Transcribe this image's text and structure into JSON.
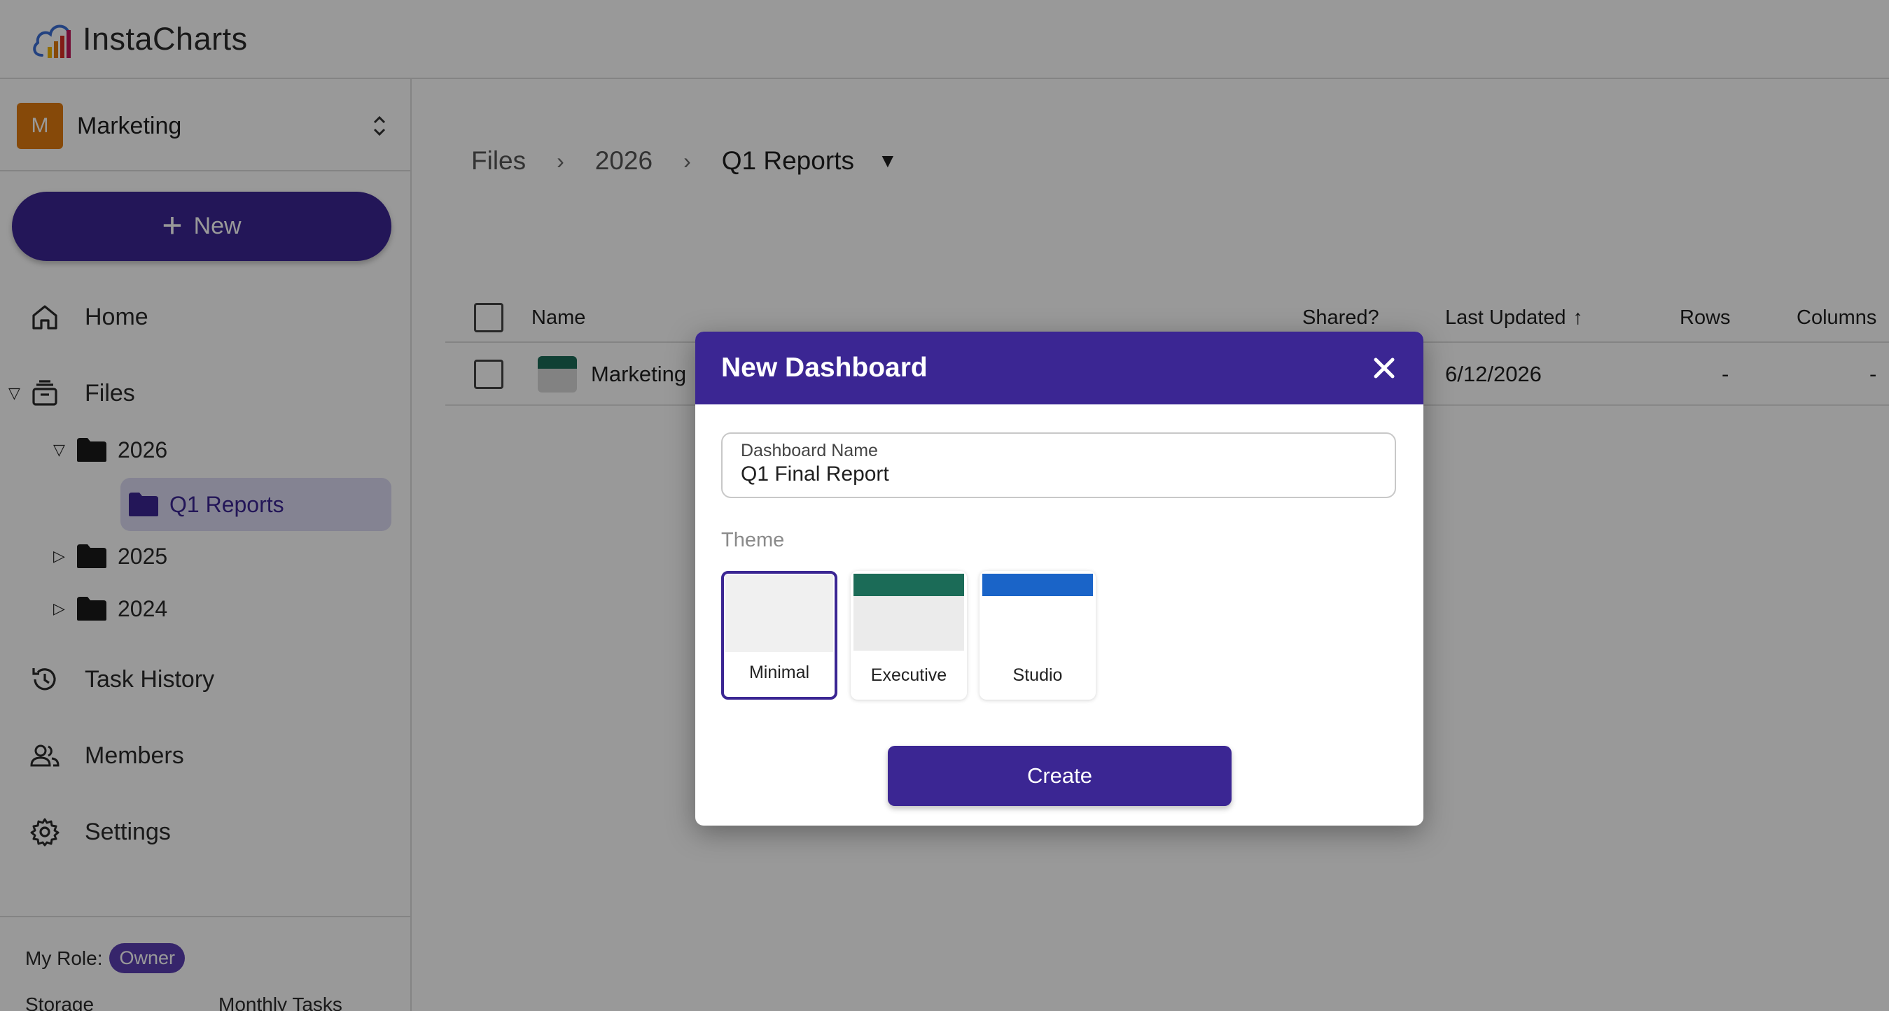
{
  "app": {
    "name": "InstaCharts"
  },
  "workspace": {
    "initial": "M",
    "name": "Marketing",
    "avatar_color": "#e07a10"
  },
  "sidebar": {
    "new_label": "New",
    "nav": {
      "home": "Home",
      "files": "Files",
      "task_history": "Task History",
      "members": "Members",
      "settings": "Settings"
    },
    "tree": {
      "y2026": "2026",
      "q1_reports": "Q1 Reports",
      "y2025": "2025",
      "y2024": "2024"
    },
    "role_label": "My Role:",
    "role_value": "Owner",
    "storage_label": "Storage",
    "monthly_tasks_label": "Monthly Tasks"
  },
  "breadcrumb": {
    "root": "Files",
    "level1": "2026",
    "current": "Q1 Reports"
  },
  "table": {
    "headers": {
      "name": "Name",
      "shared": "Shared?",
      "last_updated": "Last Updated",
      "sort_indicator": "↑",
      "rows": "Rows",
      "columns": "Columns"
    },
    "rows": [
      {
        "name": "Marketing",
        "last_updated": "6/12/2026",
        "rows": "-",
        "columns": "-"
      }
    ]
  },
  "modal": {
    "title": "New Dashboard",
    "name_field_label": "Dashboard Name",
    "name_field_value": "Q1 Final Report",
    "theme_label": "Theme",
    "themes": [
      {
        "name": "Minimal",
        "selected": true,
        "header_color": "#f0f0f0"
      },
      {
        "name": "Executive",
        "selected": false,
        "header_color": "#1b6b57"
      },
      {
        "name": "Studio",
        "selected": false,
        "header_color": "#1a64c8"
      }
    ],
    "create_label": "Create"
  },
  "colors": {
    "primary": "#3b2693",
    "selected_bg": "#dcdaf4",
    "role_badge": "#5a3fb3"
  }
}
